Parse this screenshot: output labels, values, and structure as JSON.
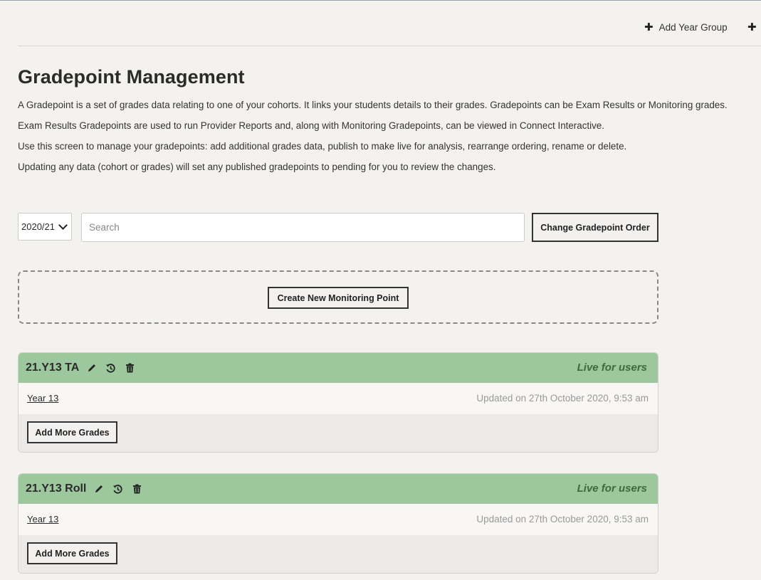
{
  "top_actions": {
    "add_year_group": "Add Year Group"
  },
  "page": {
    "title": "Gradepoint Management",
    "description": [
      "A Gradepoint is a set of grades data relating to one of your cohorts. It links your students details to their grades. Gradepoints can be Exam Results or Monitoring grades.",
      "Exam Results Gradepoints are used to run Provider Reports and, along with Monitoring Gradepoints, can be viewed in Connect Interactive.",
      "Use this screen to manage your gradepoints: add additional grades data, publish to make live for analysis, rearrange ordering, rename or delete.",
      "Updating any data (cohort or grades) will set any published gradepoints to pending for you to review the changes."
    ]
  },
  "toolbar": {
    "year_select_value": "2020/21",
    "search_placeholder": "Search",
    "change_order_label": "Change Gradepoint Order"
  },
  "create": {
    "label": "Create New Monitoring Point"
  },
  "gradepoints": [
    {
      "name": "21.Y13 TA",
      "status": "Live for users",
      "cohort": "Year 13",
      "updated": "Updated on 27th October 2020, 9:53 am",
      "add_grades_label": "Add More Grades"
    },
    {
      "name": "21.Y13 Roll",
      "status": "Live for users",
      "cohort": "Year 13",
      "updated": "Updated on 27th October 2020, 9:53 am",
      "add_grades_label": "Add More Grades"
    }
  ],
  "colors": {
    "background": "#f4f2ef",
    "card_header": "#9dc79c",
    "status_text": "#3f6a3f"
  },
  "icons": [
    "plus-icon",
    "pencil-icon",
    "history-icon",
    "trash-icon",
    "chevron-down-icon"
  ]
}
